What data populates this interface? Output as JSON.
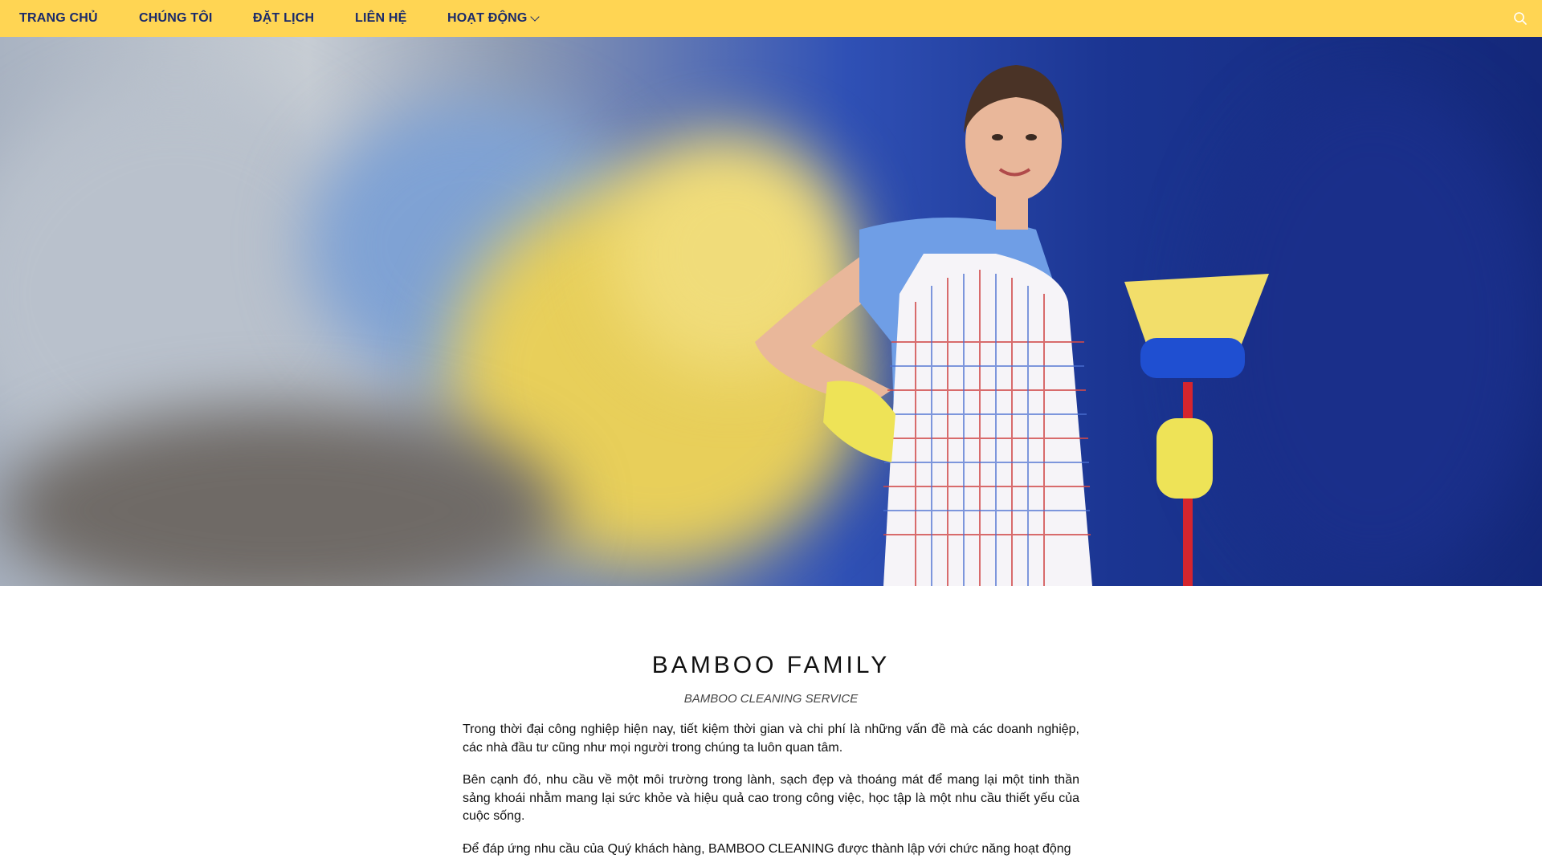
{
  "nav": {
    "items": [
      {
        "label": "TRANG CHỦ"
      },
      {
        "label": "CHÚNG TÔI"
      },
      {
        "label": "ĐẶT LỊCH"
      },
      {
        "label": "LIÊN HỆ"
      },
      {
        "label": "HOẠT ĐỘNG"
      }
    ],
    "search_icon": "search-icon",
    "dropdown_icon": "chevron-down-icon"
  },
  "colors": {
    "nav_background": "#ffd553",
    "nav_text": "#1a2a6b",
    "hero_blue": "#1b3592"
  },
  "content": {
    "title": "BAMBOO FAMILY",
    "subtitle": "BAMBOO CLEANING SERVICE",
    "paragraphs": [
      "Trong thời đại công nghiệp hiện nay, tiết kiệm thời gian và chi phí là những vấn đề mà các doanh nghiệp, các nhà đầu tư cũng như mọi người trong chúng ta luôn quan tâm.",
      "Bên cạnh đó, nhu cầu về một môi trường trong lành, sạch đẹp và thoáng mát để mang lại một tinh thần sảng khoái nhằm mang lại sức khỏe và hiệu quả cao trong công việc, học tập là một nhu cầu thiết yếu của cuộc sống.",
      "Để đáp ứng nhu cầu của Quý khách hàng, BAMBOO CLEANING được thành lập với chức năng hoạt động"
    ]
  }
}
